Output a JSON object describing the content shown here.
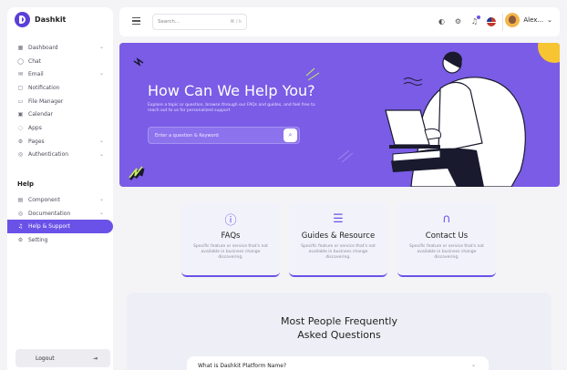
{
  "brand": {
    "name": "Dashkit"
  },
  "sidebar": {
    "items": [
      {
        "label": "Dashboard",
        "icon": "grid-icon",
        "glyph": "▦",
        "chevron": true
      },
      {
        "label": "Chat",
        "icon": "chat-icon",
        "glyph": "◯",
        "chevron": false
      },
      {
        "label": "Email",
        "icon": "mail-icon",
        "glyph": "✉",
        "chevron": true
      },
      {
        "label": "Notification",
        "icon": "bell-icon",
        "glyph": "▢",
        "chevron": false
      },
      {
        "label": "File Manager",
        "icon": "folder-icon",
        "glyph": "▭",
        "chevron": false
      },
      {
        "label": "Calendar",
        "icon": "calendar-icon",
        "glyph": "▣",
        "chevron": false
      },
      {
        "label": "Apps",
        "icon": "apps-icon",
        "glyph": "◌",
        "chevron": false
      },
      {
        "label": "Pages",
        "icon": "pages-icon",
        "glyph": "⚙",
        "chevron": true
      },
      {
        "label": "Authentication",
        "icon": "lock-icon",
        "glyph": "◎",
        "chevron": true
      }
    ],
    "section_title": "Help",
    "help_items": [
      {
        "label": "Component",
        "icon": "component-icon",
        "glyph": "▤",
        "chevron": true
      },
      {
        "label": "Documentation",
        "icon": "document-icon",
        "glyph": "◎",
        "chevron": true
      },
      {
        "label": "Help & Support",
        "icon": "headset-icon",
        "glyph": "♫",
        "chevron": false,
        "active": true
      },
      {
        "label": "Setting",
        "icon": "gear-icon",
        "glyph": "⚙",
        "chevron": false
      }
    ],
    "logout_label": "Logout",
    "logout_icon": "⇥"
  },
  "header": {
    "search_placeholder": "Search...",
    "search_shortcut": "⌘ / k",
    "user_name": "Alex...",
    "chevron": "⌄"
  },
  "hero": {
    "title": "How Can We Help You?",
    "subtitle": "Explore a topic or question, browse through our FAQs and guides, and feel free to reach out to us for personalized support",
    "search_placeholder": "Enter a question & Keyword",
    "search_icon": "⌕"
  },
  "cards": [
    {
      "title": "FAQs",
      "desc": "Specific feature or service that's not available in business change discovering.",
      "icon": "alert-circle-icon",
      "glyph": "ⓘ"
    },
    {
      "title": "Guides & Resource",
      "desc": "Specific feature or service that's not available in business change discovering.",
      "icon": "document-lines-icon",
      "glyph": "☰"
    },
    {
      "title": "Contact Us",
      "desc": "Specific feature or service that's not available in business change discovering.",
      "icon": "headphones-icon",
      "glyph": "∩"
    }
  ],
  "faq": {
    "title_line1": "Most People Frequently",
    "title_line2": "Asked Questions",
    "first_question": "What is Dashkit Platform Name?",
    "chevron": "⌄"
  },
  "colors": {
    "accent": "#6a52e8",
    "hero_bg": "#7a5ce6",
    "yellow": "#f6c531"
  }
}
